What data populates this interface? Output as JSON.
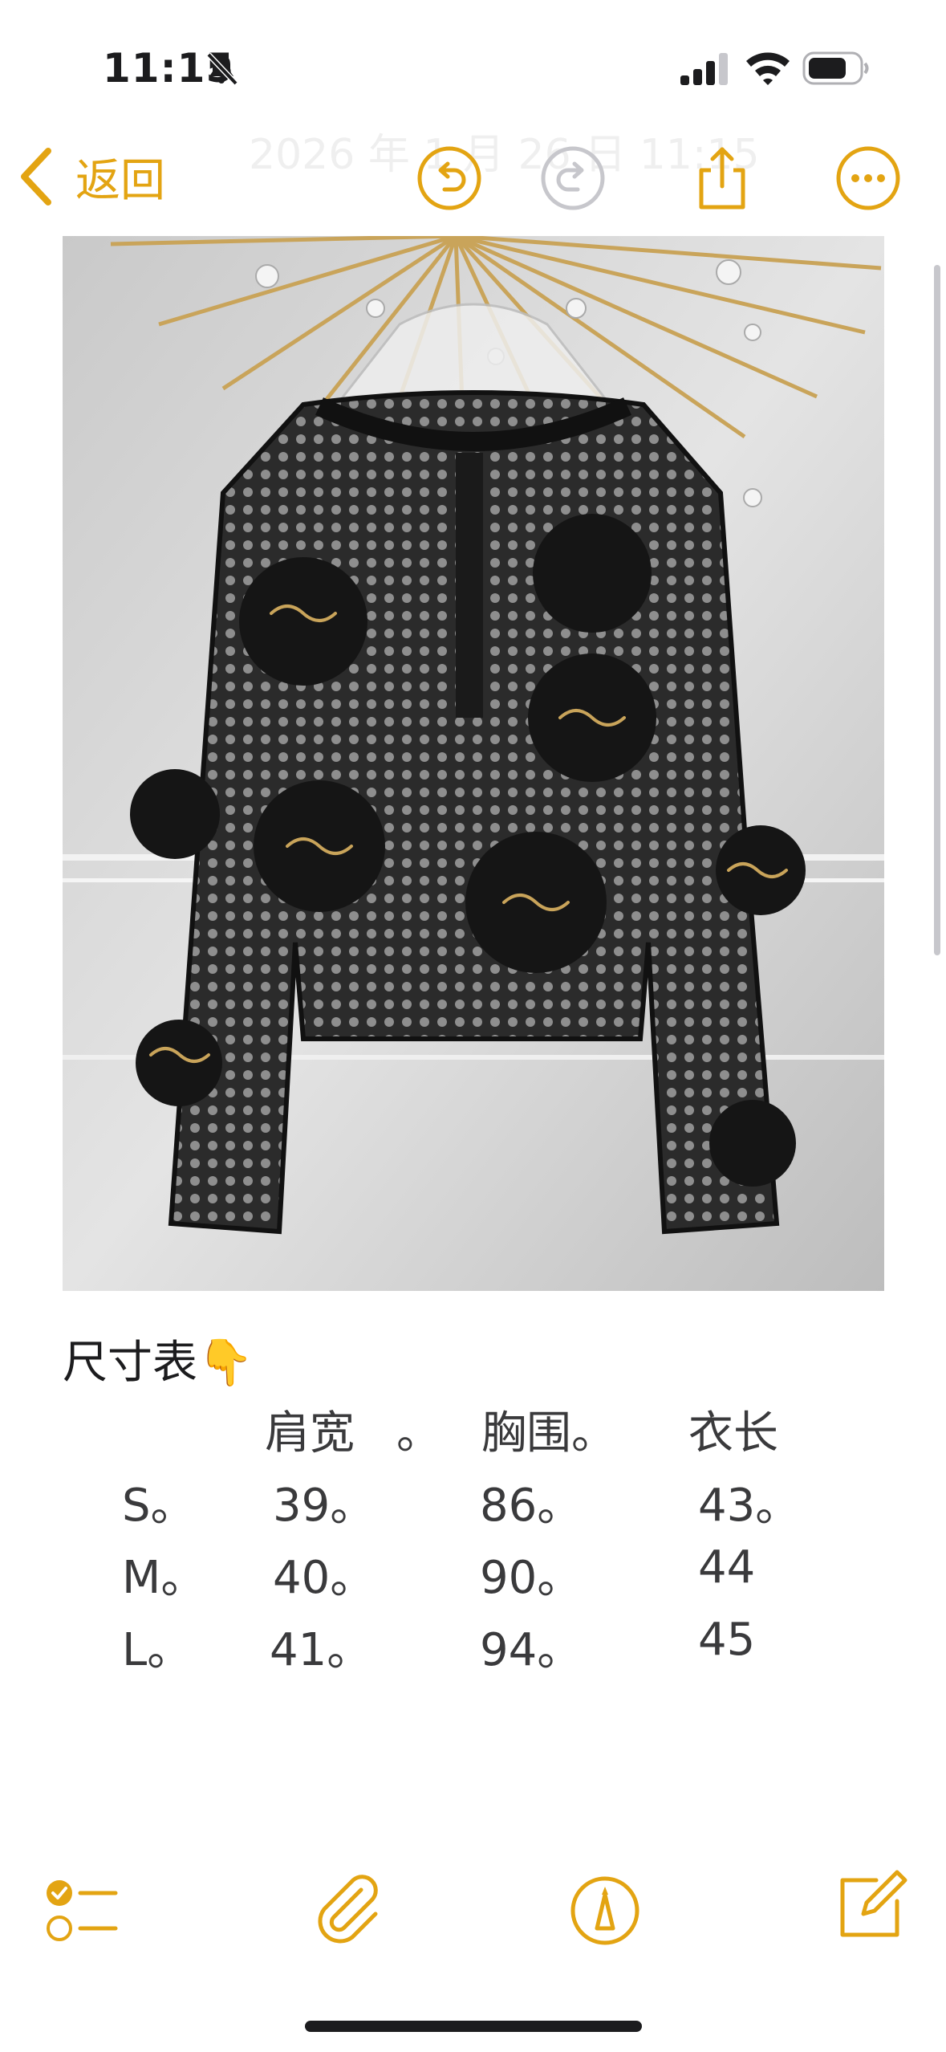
{
  "status_bar": {
    "time": "11:15",
    "icons": [
      "bell-slash-icon",
      "cellular-signal-icon",
      "wifi-icon",
      "battery-icon"
    ]
  },
  "nav": {
    "back_label": "返回",
    "date_text": "2026 年 1 月 26 日 11:15",
    "icons": [
      "chevron-left-icon",
      "undo-icon",
      "redo-icon",
      "share-icon",
      "more-icon"
    ]
  },
  "note": {
    "size_title": "尺寸表👇",
    "table": {
      "header": [
        "肩宽",
        "。",
        "胸围。",
        "衣长"
      ],
      "rows": [
        {
          "size": "S。",
          "shoulder": "39。",
          "chest": "86。",
          "length": "43。"
        },
        {
          "size": "M。",
          "shoulder": "40。",
          "chest": "90。",
          "length": "44"
        },
        {
          "size": "L。",
          "shoulder": "41。",
          "chest": "94。",
          "length": "45"
        }
      ]
    }
  },
  "toolbar": {
    "icons": [
      "checklist-icon",
      "attachment-icon",
      "markup-icon",
      "compose-icon"
    ]
  },
  "colors": {
    "accent": "#e3a412",
    "text": "#1c1c1e",
    "table_text": "#3a3a3c",
    "background": "#ffffff"
  }
}
